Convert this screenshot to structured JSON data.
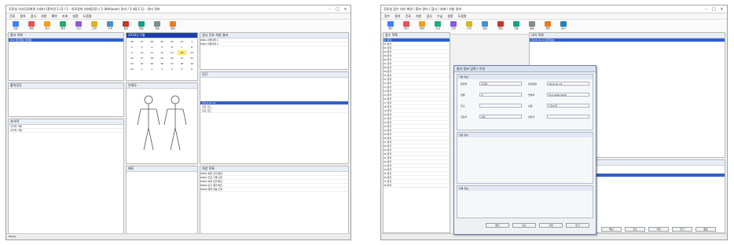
{
  "left_window": {
    "title": "진료실 의사진료화면 (내과) [홈어린 1-2] / 1 - 의료정보 (외래진료) / 2 (Ktitioner) 관리 / 3 (KJ 1-1) - 관리 정보",
    "menu": [
      "진료",
      "환자",
      "검사",
      "처방",
      "예약",
      "조회",
      "설정",
      "도움말"
    ],
    "toolbar": [
      "진료",
      "처방",
      "검사",
      "예약",
      "수납",
      "조회",
      "출력",
      "설정",
      "메모",
      "전송",
      "종료"
    ],
    "calendar_days": [
      "26",
      "27",
      "28",
      "29",
      "30",
      "31",
      "1",
      "2",
      "3",
      "4",
      "5",
      "6",
      "7",
      "8",
      "9",
      "10",
      "11",
      "12",
      "13",
      "14",
      "15",
      "16",
      "17",
      "18",
      "19",
      "20",
      "21",
      "22",
      "23",
      "24",
      "25",
      "26",
      "27",
      "28",
      "29",
      "30",
      "1",
      "2",
      "3",
      "4",
      "5",
      "6"
    ],
    "table_header": "검사 진료 처방 결과",
    "order_rows": [
      "PRN1  처방내역  1",
      "PRN2  처방내역  2"
    ],
    "list_rows": [
      "MN01  처방 조회 결과",
      "MN02  진료 기록 조회",
      "MN03  처방 입력 확인",
      "MN04  검사 결과 확인",
      "MN05  예약 현황 조회"
    ],
    "selected_item": "2016-01-14",
    "status": "Ready"
  },
  "right_window": {
    "title": "진료실 접수 대기 화면 / 환자 관리 / 검사 / 외래 / 처방 관리",
    "menu": [
      "접수",
      "환자",
      "진료",
      "처방",
      "검사",
      "수납",
      "설정",
      "도움말"
    ],
    "toolbar": [
      "접수",
      "환자",
      "예약",
      "수납",
      "조회",
      "출력",
      "설정",
      "메모",
      "전송",
      "종료",
      "처방",
      "검사"
    ],
    "patient_rows": 38,
    "selected_row": "2016-01-14  환자정보",
    "bottom_buttons": [
      "확인",
      "취소",
      "저장",
      "닫기",
      "종료"
    ]
  },
  "dialog": {
    "title": "환자 정보 입력 / 수정",
    "group1": "기본 정보",
    "group2": "진료 정보",
    "group3": "처방 정보",
    "labels": [
      "환자명",
      "생년월일",
      "성별",
      "연락처",
      "주소",
      "보험",
      "진료과",
      "담당의"
    ],
    "values": [
      "홍길동",
      "2016-01-14",
      "남",
      "010-0000-0000",
      "",
      "건강보험",
      "내과",
      ""
    ],
    "buttons": [
      "확인",
      "취소",
      "저장",
      "닫기"
    ]
  }
}
